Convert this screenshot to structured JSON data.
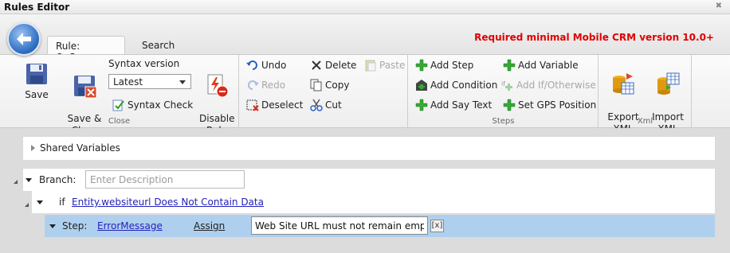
{
  "window": {
    "title": "Rules Editor",
    "close_glyph": "✖"
  },
  "tabs": [
    {
      "label": "Rule: OnSave"
    },
    {
      "label": "Search"
    }
  ],
  "notice": "Required minimal Mobile CRM version 10.0+",
  "ribbon": {
    "close_group": {
      "label": "Close",
      "save": "Save",
      "save_close": "Save &\nClose",
      "syntax_version_label": "Syntax version",
      "syntax_version_value": "Latest",
      "syntax_check": "Syntax Check",
      "disable_rule": "Disable\nRule"
    },
    "edit_group": {
      "undo": "Undo",
      "redo": "Redo",
      "deselect": "Deselect",
      "delete": "Delete",
      "copy": "Copy",
      "cut": "Cut",
      "paste": "Paste"
    },
    "steps_group": {
      "label": "Steps",
      "add_step": "Add Step",
      "add_condition": "Add Condition",
      "add_say_text": "Add Say Text",
      "add_variable": "Add Variable",
      "add_if_otherwise": "Add If/Otherwise",
      "set_gps_position": "Set GPS Position"
    },
    "xml_group": {
      "label": "Xml",
      "export": "Export\nXML",
      "import": "Import\nXML"
    }
  },
  "tree": {
    "shared_variables": "Shared Variables",
    "branch_label": "Branch:",
    "branch_placeholder": "Enter Description",
    "if_keyword": "if",
    "condition": "Entity.websiteurl Does Not Contain Data",
    "step_label": "Step:",
    "step_name": "ErrorMessage",
    "step_action": "Assign",
    "message_value": "Web Site URL must not remain empty!",
    "clear_label": "[x]"
  },
  "colors": {
    "accent_red": "#e00000",
    "selection": "#aed0ee",
    "link": "#2222bb"
  }
}
